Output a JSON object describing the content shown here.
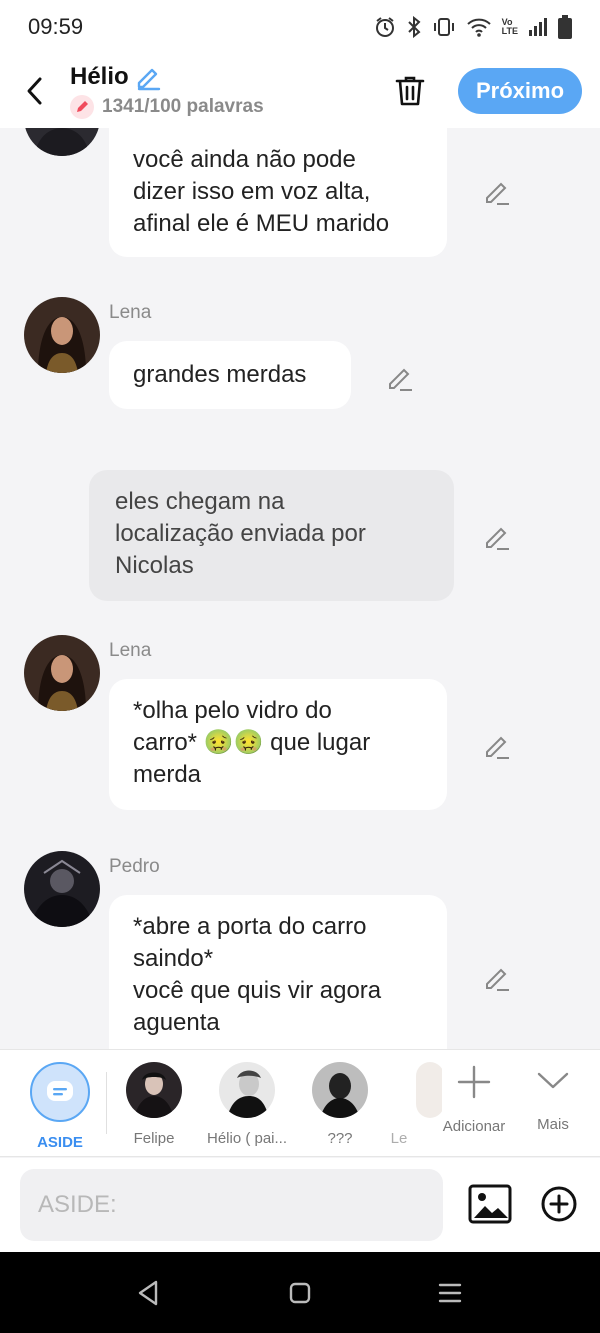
{
  "status": {
    "time": "09:59",
    "icons": [
      "alarm-icon",
      "bluetooth-icon",
      "vibrate-icon",
      "wifi-icon",
      "volte-icon",
      "signal-icon",
      "battery-icon"
    ],
    "volte_label": "Vo\nLTE"
  },
  "header": {
    "title": "Hélio",
    "word_count": "1341/100 palavras",
    "next_label": "Próximo",
    "accent_color": "#5aa7f4"
  },
  "messages": [
    {
      "type": "character",
      "sender": "",
      "text": "você ainda não pode\ndizer isso em voz alta,\nafinal ele é MEU marido"
    },
    {
      "type": "character",
      "sender": "Lena",
      "text": "grandes merdas"
    },
    {
      "type": "narration",
      "text": "eles chegam na\nlocalização enviada por\nNicolas"
    },
    {
      "type": "character",
      "sender": "Lena",
      "text": "*olha pelo vidro do\ncarro* 🤢🤢 que lugar\nmerda"
    },
    {
      "type": "character",
      "sender": "Pedro",
      "text": "*abre a porta do carro\nsaindo*\nvocê que quis vir agora\naguenta"
    }
  ],
  "characters": [
    {
      "label": "ASIDE",
      "active": true
    },
    {
      "label": "Felipe"
    },
    {
      "label": "Hélio ( pai..."
    },
    {
      "label": "???"
    },
    {
      "label": "Le"
    }
  ],
  "actions": {
    "add_label": "Adicionar",
    "more_label": "Mais"
  },
  "input": {
    "placeholder": "ASIDE:"
  }
}
